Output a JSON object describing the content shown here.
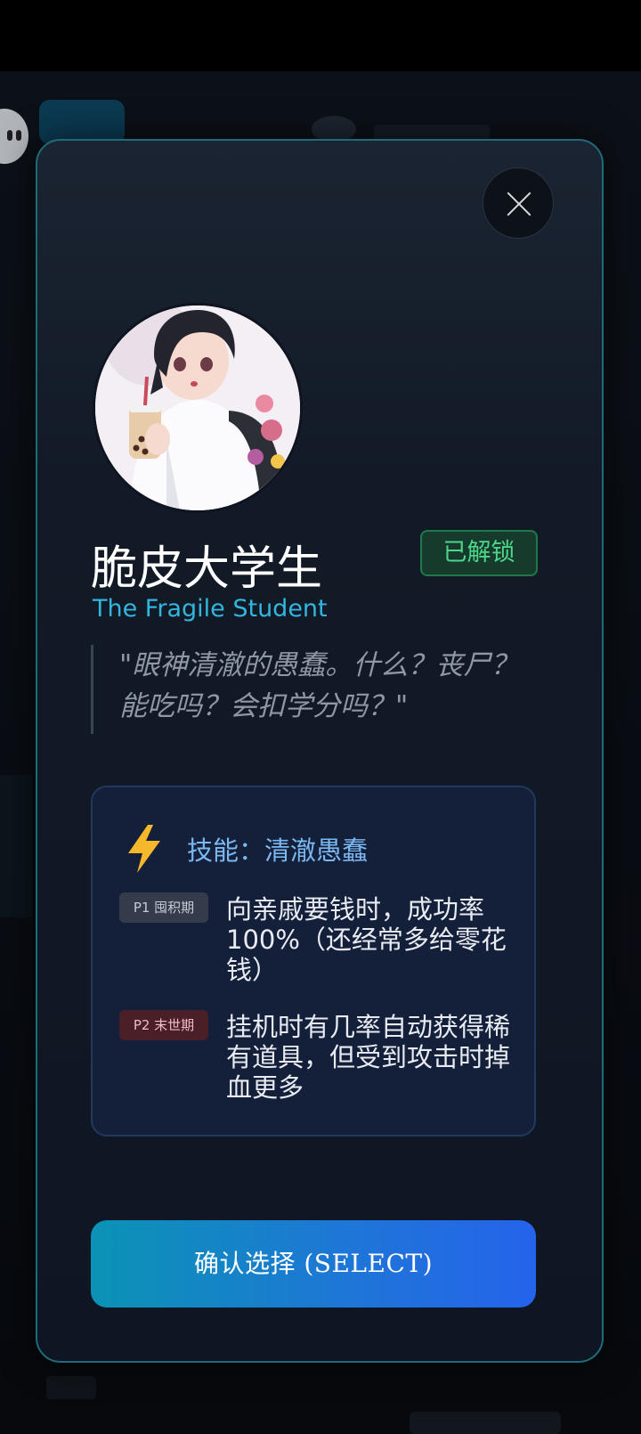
{
  "modal": {
    "close_icon": "close-icon",
    "character": {
      "name_cn": "脆皮大学生",
      "name_en": "The Fragile Student",
      "status_badge": "已解锁",
      "quote": "\"眼神清澈的愚蠢。什么？丧尸？能吃吗？会扣学分吗？\""
    },
    "skill": {
      "icon": "lightning-icon",
      "title": "技能：清澈愚蠢",
      "phases": [
        {
          "tag": "P1 囤积期",
          "description": "向亲戚要钱时，成功率100%（还经常多给零花钱）"
        },
        {
          "tag": "P2 末世期",
          "description": "挂机时有几率自动获得稀有道具，但受到攻击时掉血更多"
        }
      ]
    },
    "confirm_label": "确认选择 (SELECT)"
  },
  "colors": {
    "accent_cyan": "#33b5e0",
    "badge_green": "#4ed68b",
    "skill_blue": "#7ab8f0",
    "button_gradient_start": "#0b93b5",
    "button_gradient_end": "#2563eb"
  }
}
